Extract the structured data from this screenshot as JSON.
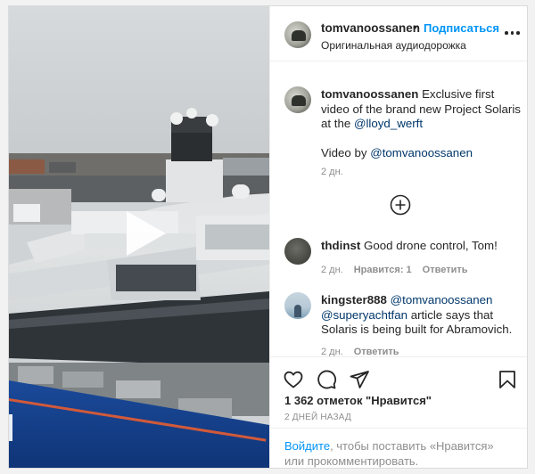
{
  "header": {
    "username": "tomvanoossanen",
    "separator": "•",
    "follow_label": "Подписаться",
    "audio_label": "Оригинальная аудиодорожка",
    "more_icon": "more-horizontal-icon"
  },
  "caption": {
    "username": "tomvanoossanen",
    "text_before": "Exclusive first video of the brand new Project Solaris at the",
    "mention": "@lloyd_werft",
    "credit_prefix": "Video by",
    "credit_mention": "@tomvanoossanen",
    "time": "2 дн."
  },
  "load_more_icon": "plus-circle-icon",
  "comments": [
    {
      "username": "thdinst",
      "text": "Good drone control, Tom!",
      "time": "2 дн.",
      "likes_label": "Нравится: 1",
      "reply_label": "Ответить"
    },
    {
      "username": "kingster888",
      "mention1": "@tomvanoossanen",
      "mention2": "@superyachtfan",
      "text": "article says that Solaris is being built for Abramovich.",
      "time": "2 дн.",
      "reply_label": "Ответить"
    }
  ],
  "actions": {
    "like_icon": "heart-icon",
    "comment_icon": "comment-icon",
    "share_icon": "send-icon",
    "save_icon": "bookmark-icon",
    "likes_text": "1 362 отметок \"Нравится\"",
    "date_text": "2 ДНЕЙ НАЗАД"
  },
  "login_prompt": {
    "link": "Войдите",
    "text": ", чтобы поставить «Нравится» или прокомментировать."
  },
  "colors": {
    "accent": "#0095f6",
    "mention": "#00376b",
    "secondary_text": "#8e8e8e"
  }
}
